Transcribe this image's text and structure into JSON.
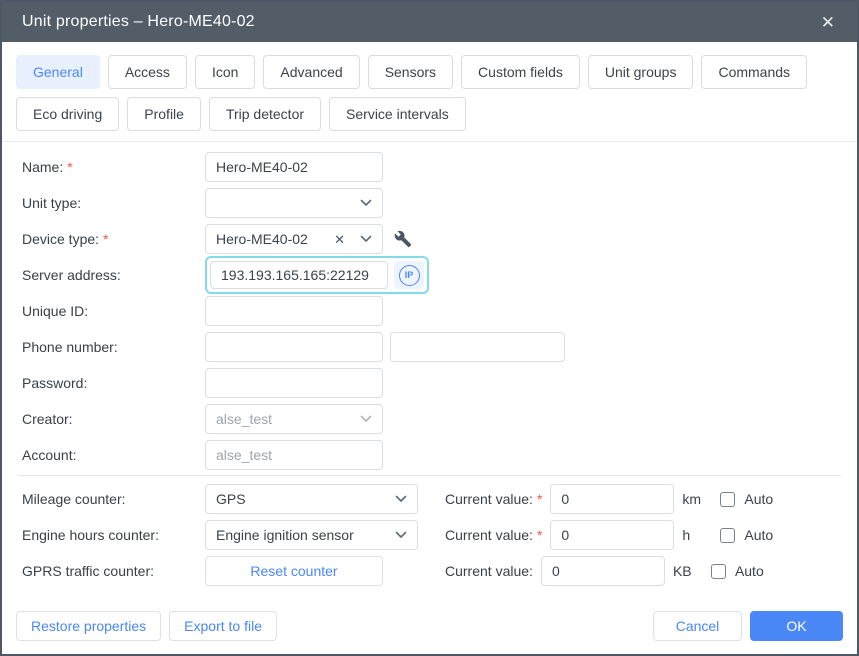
{
  "title_bar": {
    "title": "Unit properties – Hero-ME40-02",
    "close_icon": "✕"
  },
  "tabs": {
    "active": "General",
    "items": [
      "General",
      "Access",
      "Icon",
      "Advanced",
      "Sensors",
      "Custom fields",
      "Unit groups",
      "Commands",
      "Eco driving",
      "Profile",
      "Trip detector",
      "Service intervals"
    ]
  },
  "form": {
    "required_mark": "*",
    "name": {
      "label": "Name:",
      "value": "Hero-ME40-02"
    },
    "unit_type": {
      "label": "Unit type:",
      "value": ""
    },
    "device_type": {
      "label": "Device type:",
      "value": "Hero-ME40-02"
    },
    "server_address": {
      "label": "Server address:",
      "value": "193.193.165.165:22129",
      "ip_badge": "IP"
    },
    "unique_id": {
      "label": "Unique ID:",
      "value": ""
    },
    "phone_number": {
      "label": "Phone number:",
      "value1": "",
      "value2": ""
    },
    "password": {
      "label": "Password:",
      "value": ""
    },
    "creator": {
      "label": "Creator:",
      "value": "alse_test"
    },
    "account": {
      "label": "Account:",
      "value": "alse_test"
    }
  },
  "counters": {
    "mileage": {
      "label": "Mileage counter:",
      "source": "GPS",
      "current_label": "Current value:",
      "value": "0",
      "unit": "km",
      "auto_label": "Auto"
    },
    "engine_hours": {
      "label": "Engine hours counter:",
      "source": "Engine ignition sensor",
      "current_label": "Current value:",
      "value": "0",
      "unit": "h",
      "auto_label": "Auto"
    },
    "gprs_traffic": {
      "label": "GPRS traffic counter:",
      "reset_button": "Reset counter",
      "current_label": "Current value:",
      "value": "0",
      "unit": "KB",
      "auto_label": "Auto"
    }
  },
  "footer": {
    "restore": "Restore properties",
    "export": "Export to file",
    "cancel": "Cancel",
    "ok": "OK"
  },
  "colors": {
    "accent": "#4a87f7",
    "title_bar": "#525d68",
    "active_tab_bg": "#e8f0fe",
    "focus_ring": "#84d9ec",
    "required": "#f4594e"
  }
}
